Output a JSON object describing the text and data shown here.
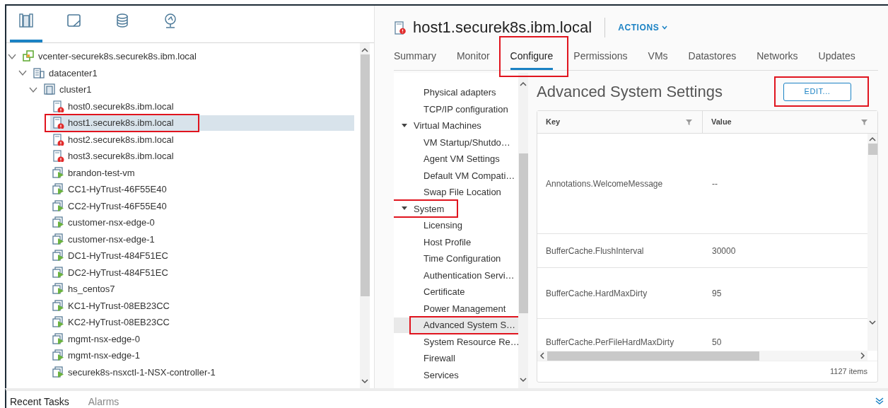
{
  "nav_icons": [
    {
      "kind": "hosts",
      "selected": true
    },
    {
      "kind": "vms",
      "selected": false
    },
    {
      "kind": "storage",
      "selected": false
    },
    {
      "kind": "network",
      "selected": false
    }
  ],
  "tree": [
    {
      "label": "vcenter-securek8s.securek8s.ibm.local",
      "kind": "vcenter",
      "expanded": true,
      "selected": false,
      "annotated": false,
      "children": [
        {
          "label": "datacenter1",
          "kind": "datacenter",
          "expanded": true,
          "selected": false,
          "annotated": false,
          "children": [
            {
              "label": "cluster1",
              "kind": "cluster",
              "expanded": true,
              "selected": false,
              "annotated": false,
              "children": [
                {
                  "label": "host0.securek8s.ibm.local",
                  "kind": "host",
                  "selected": false,
                  "annotated": false
                },
                {
                  "label": "host1.securek8s.ibm.local",
                  "kind": "host",
                  "selected": true,
                  "annotated": true
                },
                {
                  "label": "host2.securek8s.ibm.local",
                  "kind": "host",
                  "selected": false,
                  "annotated": false
                },
                {
                  "label": "host3.securek8s.ibm.local",
                  "kind": "host",
                  "selected": false,
                  "annotated": false
                },
                {
                  "label": "brandon-test-vm",
                  "kind": "vm",
                  "selected": false,
                  "annotated": false
                },
                {
                  "label": "CC1-HyTrust-46F55E40",
                  "kind": "vm",
                  "selected": false,
                  "annotated": false
                },
                {
                  "label": "CC2-HyTrust-46F55E40",
                  "kind": "vm",
                  "selected": false,
                  "annotated": false
                },
                {
                  "label": "customer-nsx-edge-0",
                  "kind": "vm",
                  "selected": false,
                  "annotated": false
                },
                {
                  "label": "customer-nsx-edge-1",
                  "kind": "vm",
                  "selected": false,
                  "annotated": false
                },
                {
                  "label": "DC1-HyTrust-484F51EC",
                  "kind": "vm",
                  "selected": false,
                  "annotated": false
                },
                {
                  "label": "DC2-HyTrust-484F51EC",
                  "kind": "vm",
                  "selected": false,
                  "annotated": false
                },
                {
                  "label": "hs_centos7",
                  "kind": "vm",
                  "selected": false,
                  "annotated": false
                },
                {
                  "label": "KC1-HyTrust-08EB23CC",
                  "kind": "vm",
                  "selected": false,
                  "annotated": false
                },
                {
                  "label": "KC2-HyTrust-08EB23CC",
                  "kind": "vm",
                  "selected": false,
                  "annotated": false
                },
                {
                  "label": "mgmt-nsx-edge-0",
                  "kind": "vm",
                  "selected": false,
                  "annotated": false
                },
                {
                  "label": "mgmt-nsx-edge-1",
                  "kind": "vm",
                  "selected": false,
                  "annotated": false
                },
                {
                  "label": "securek8s-nsxctl-1-NSX-controller-1",
                  "kind": "vm",
                  "selected": false,
                  "annotated": false
                }
              ]
            }
          ]
        }
      ]
    }
  ],
  "object": {
    "title": "host1.securek8s.ibm.local",
    "actions": "ACTIONS"
  },
  "tabs": [
    {
      "label": "Summary",
      "selected": false,
      "annotated": false
    },
    {
      "label": "Monitor",
      "selected": false,
      "annotated": false
    },
    {
      "label": "Configure",
      "selected": true,
      "annotated": true
    },
    {
      "label": "Permissions",
      "selected": false,
      "annotated": false
    },
    {
      "label": "VMs",
      "selected": false,
      "annotated": false
    },
    {
      "label": "Datastores",
      "selected": false,
      "annotated": false
    },
    {
      "label": "Networks",
      "selected": false,
      "annotated": false
    },
    {
      "label": "Updates",
      "selected": false,
      "annotated": false
    }
  ],
  "config_nav": [
    {
      "label": "Physical adapters",
      "selected": false,
      "annotated": false
    },
    {
      "label": "TCP/IP configuration",
      "selected": false,
      "annotated": false
    },
    {
      "label": "Virtual Machines",
      "expanded": true,
      "selected": false,
      "annotated": false,
      "children": [
        {
          "label": "VM Startup/Shutdo…",
          "selected": false,
          "annotated": false
        },
        {
          "label": "Agent VM Settings",
          "selected": false,
          "annotated": false
        },
        {
          "label": "Default VM Compati…",
          "selected": false,
          "annotated": false
        },
        {
          "label": "Swap File Location",
          "selected": false,
          "annotated": false
        }
      ]
    },
    {
      "label": "System",
      "expanded": true,
      "selected": false,
      "annotated": true,
      "children": [
        {
          "label": "Licensing",
          "selected": false,
          "annotated": false
        },
        {
          "label": "Host Profile",
          "selected": false,
          "annotated": false
        },
        {
          "label": "Time Configuration",
          "selected": false,
          "annotated": false
        },
        {
          "label": "Authentication Servi…",
          "selected": false,
          "annotated": false
        },
        {
          "label": "Certificate",
          "selected": false,
          "annotated": false
        },
        {
          "label": "Power Management",
          "selected": false,
          "annotated": false
        },
        {
          "label": "Advanced System S…",
          "selected": true,
          "annotated": true
        },
        {
          "label": "System Resource Re…",
          "selected": false,
          "annotated": false
        },
        {
          "label": "Firewall",
          "selected": false,
          "annotated": false
        },
        {
          "label": "Services",
          "selected": false,
          "annotated": false
        }
      ]
    }
  ],
  "settings": {
    "title": "Advanced System Settings",
    "edit_button": {
      "label": "EDIT...",
      "annotated": true
    },
    "columns": [
      "Key",
      "Value"
    ],
    "rows": [
      {
        "key": "Annotations.WelcomeMessage",
        "value": "--"
      },
      {
        "key": "BufferCache.FlushInterval",
        "value": "30000"
      },
      {
        "key": "BufferCache.HardMaxDirty",
        "value": "95"
      },
      {
        "key": "BufferCache.PerFileHardMaxDirty",
        "value": "50"
      }
    ],
    "footer": "1127 items"
  },
  "bottom_tabs": [
    {
      "label": "Recent Tasks",
      "selected": true
    },
    {
      "label": "Alarms",
      "selected": false
    }
  ]
}
